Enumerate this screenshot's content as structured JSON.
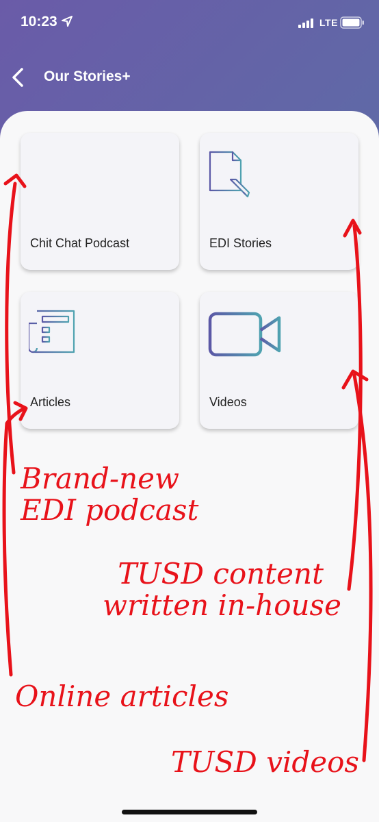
{
  "status_bar": {
    "time": "10:23",
    "network": "LTE"
  },
  "nav": {
    "title": "Our Stories+",
    "back_icon": "chevron-left-icon"
  },
  "tiles": [
    {
      "label": "Chit Chat Podcast",
      "icon": "sound-wave-icon"
    },
    {
      "label": "EDI Stories",
      "icon": "document-pencil-icon"
    },
    {
      "label": "Articles",
      "icon": "newspaper-icon"
    },
    {
      "label": "Videos",
      "icon": "video-camera-icon"
    }
  ],
  "annotations": {
    "podcast": [
      "Brand-new",
      "EDI podcast"
    ],
    "edi_stories": [
      "TUSD content",
      "written in-house"
    ],
    "articles": "Online articles",
    "videos": "TUSD videos"
  },
  "colors": {
    "annotation": "#e8121a",
    "header_start": "#6a5ba8",
    "header_end": "#5a7aa6"
  }
}
